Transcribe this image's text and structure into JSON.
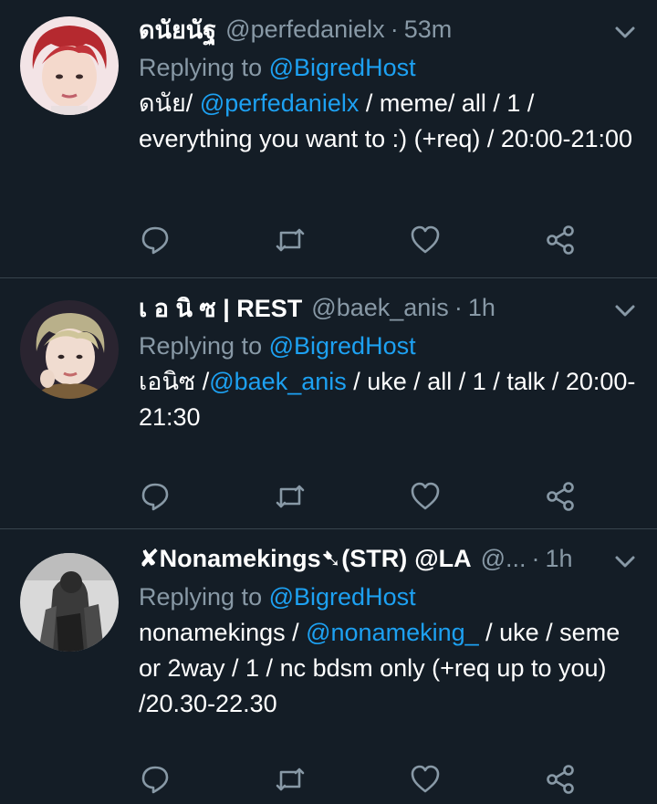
{
  "colors": {
    "background": "#141d26",
    "muted": "#8899a6",
    "accent": "#1da1f2",
    "divider": "#38444d"
  },
  "tweets": [
    {
      "name": "ดนัยนัฐ",
      "handle": "@perfedanielx",
      "sep": "·",
      "time": "53m",
      "reply_prefix": "Replying to",
      "reply_to": "@BigredHost",
      "body_pre": "ดนัย/ ",
      "body_mention": "@perfedanielx",
      "body_post": " / meme/ all / 1 / everything you want to :) (+req) / 20:00-21:00",
      "avatar_icon": "user-avatar"
    },
    {
      "name": "เ อ นิ ซ | REST",
      "handle": "@baek_anis",
      "sep": "·",
      "time": "1h",
      "reply_prefix": "Replying to",
      "reply_to": "@BigredHost",
      "body_pre": "เอนิซ /",
      "body_mention": "@baek_anis",
      "body_post": " / uke / all / 1 / talk / 20:00-21:30",
      "avatar_icon": "user-avatar"
    },
    {
      "name": "✘Nonamekings➷(STR)",
      "handle": "@LA",
      "handle_trunc": "@...",
      "sep": "·",
      "time": "1h",
      "reply_prefix": "Replying to",
      "reply_to": "@BigredHost",
      "body_pre": "nonamekings / ",
      "body_mention": "@nonameking_",
      "body_post": " / uke / seme or 2way / 1 / nc bdsm only  (+req up to you) /20.30-22.30",
      "avatar_icon": "user-avatar"
    }
  ],
  "icons": [
    "reply-icon",
    "retweet-icon",
    "like-icon",
    "share-icon",
    "chevron-down-icon"
  ]
}
